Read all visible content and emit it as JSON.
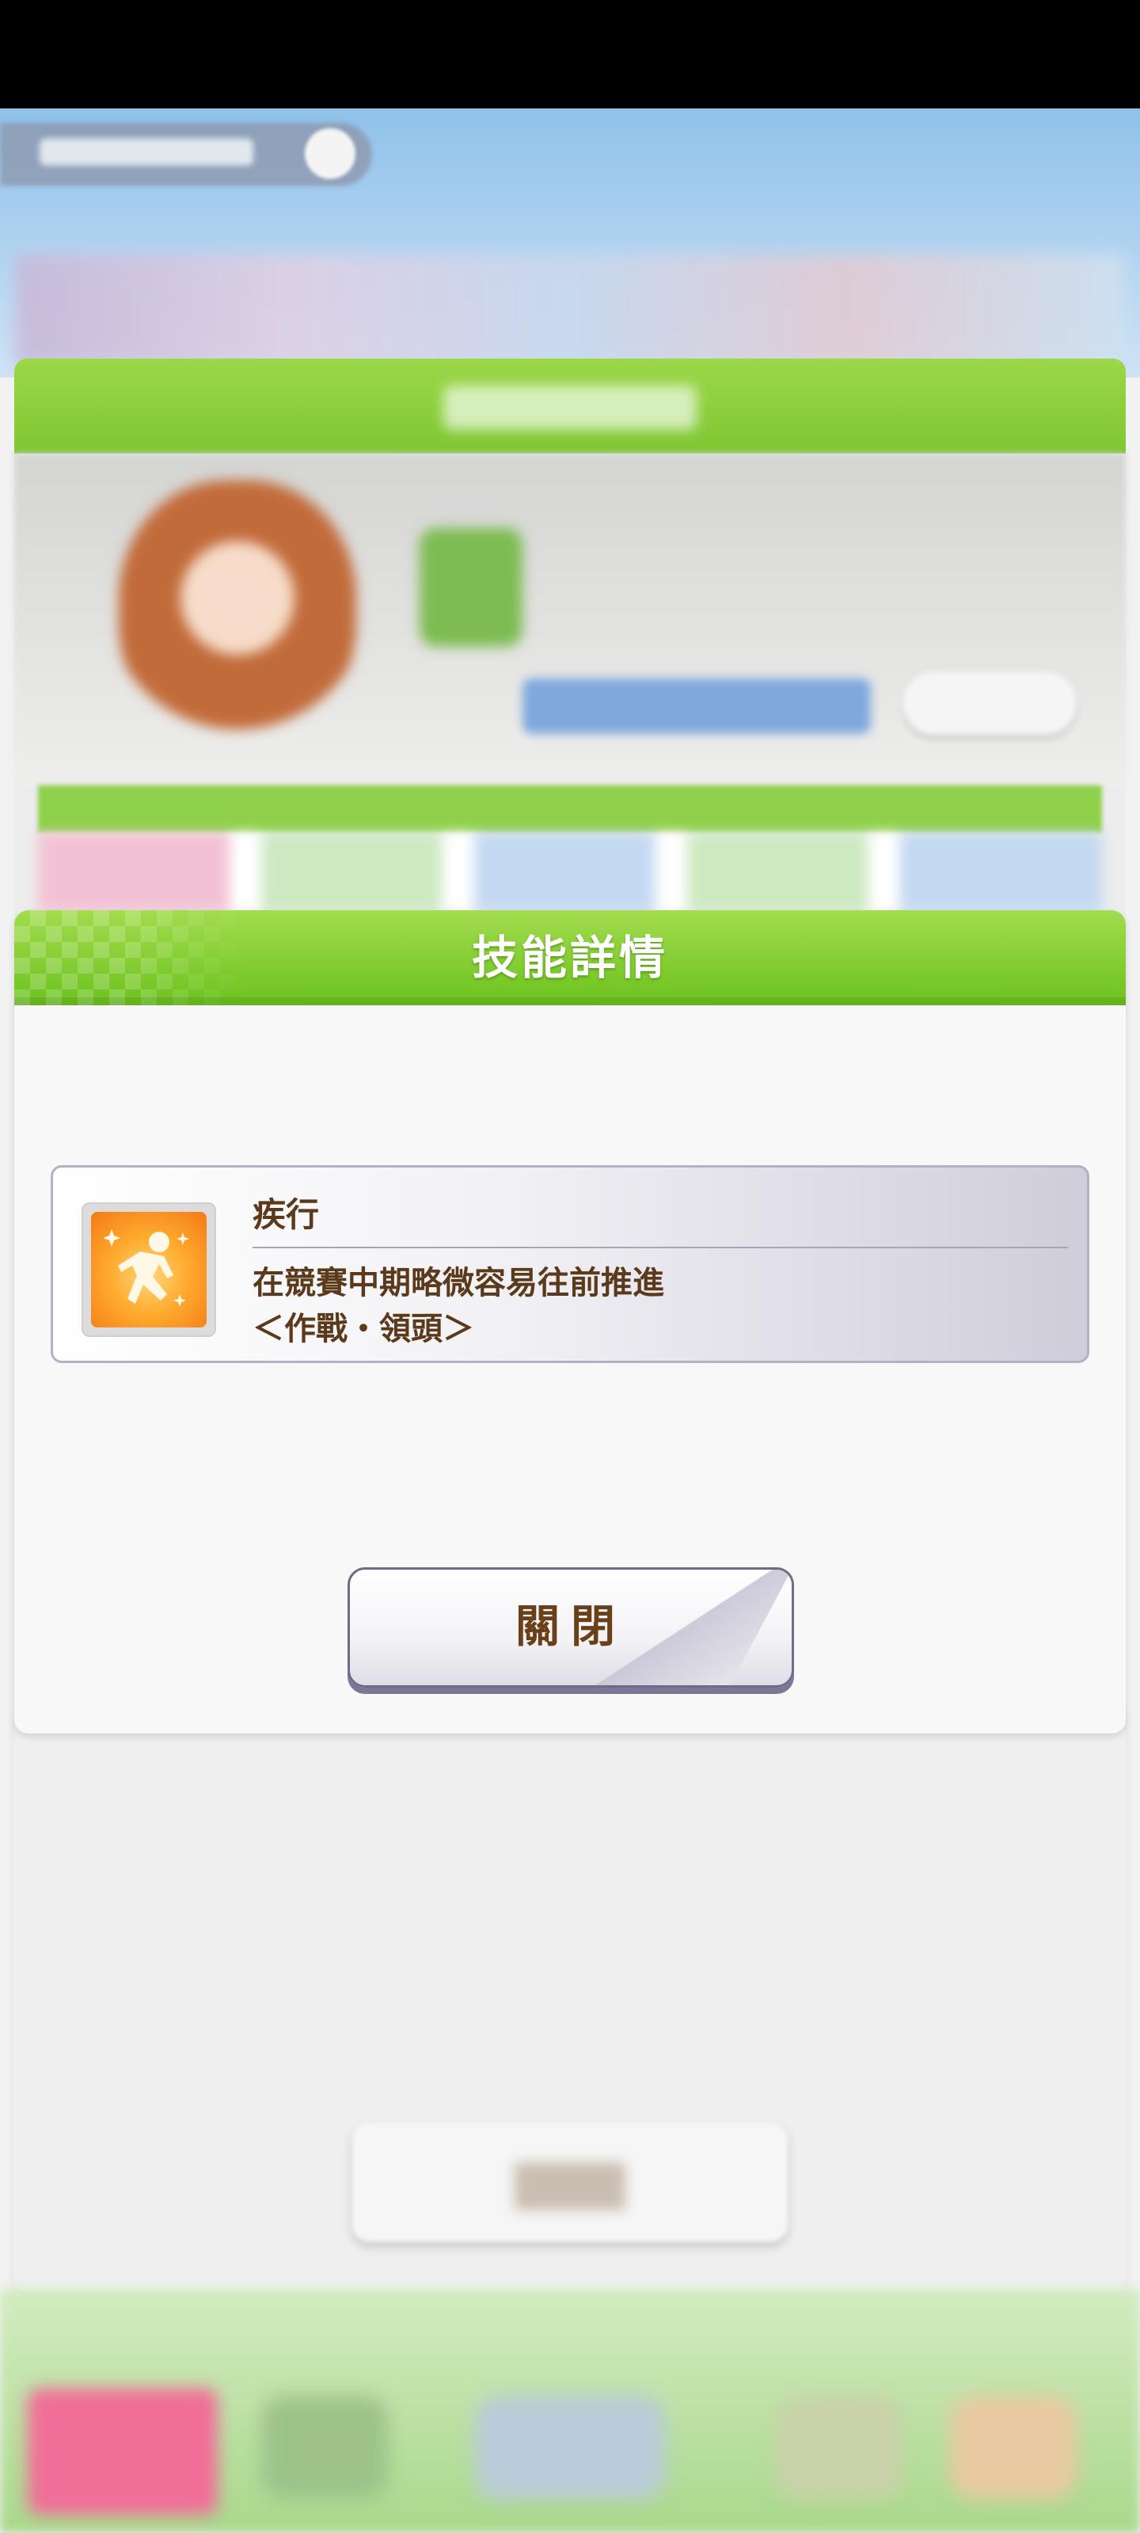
{
  "modal": {
    "title": "技能詳情",
    "skill": {
      "name": "疾行",
      "description": "在競賽中期略微容易往前推進",
      "tags": "＜作戰・領頭＞",
      "icon": "running-figure-icon"
    },
    "close_label": "關閉"
  },
  "colors": {
    "header_green": "#7fc632",
    "text_brown": "#5b3a1b",
    "icon_orange": "#f37a16"
  }
}
